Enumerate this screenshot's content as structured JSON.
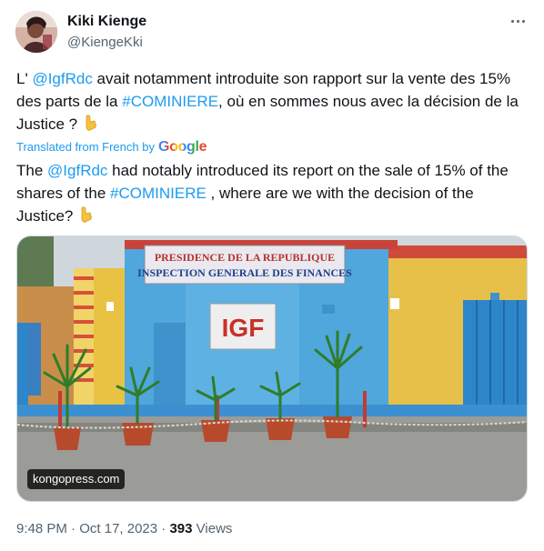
{
  "author": {
    "name": "Kiki Kienge",
    "handle": "@KiengeKki"
  },
  "tweet": {
    "original": {
      "part1": "L' ",
      "mention": "@IgfRdc",
      "part2": " avait notamment introduite son rapport sur la vente des 15% des parts de la ",
      "hashtag": "#COMINIERE",
      "part3": ", où en sommes nous avec la décision de la Justice ? ",
      "emoji": "👇"
    },
    "translated_label": "Translated from French by",
    "translator": "Google",
    "translation": {
      "part1": "The ",
      "mention": "@IgfRdc",
      "part2": " had notably introduced its report on the sale of 15% of the shares of the ",
      "hashtag": "#COMINIERE",
      "part3": " , where are we with the decision of the Justice? ",
      "emoji": "👇"
    }
  },
  "media": {
    "sign_line1": "PRESIDENCE DE LA REPUBLIQUE",
    "sign_line2": "INSPECTION GENERALE DES FINANCES",
    "plaque": "IGF",
    "source_label": "kongopress.com"
  },
  "footer": {
    "time": "9:48 PM",
    "date": "Oct 17, 2023",
    "views_count": "393",
    "views_label": "Views"
  },
  "colors": {
    "link": "#1d9bf0",
    "secondary": "#536471",
    "border": "#cfd9de"
  },
  "icons": {
    "more": "more-horizontal-icon",
    "emoji": "backhand-index-pointing-down-emoji"
  }
}
